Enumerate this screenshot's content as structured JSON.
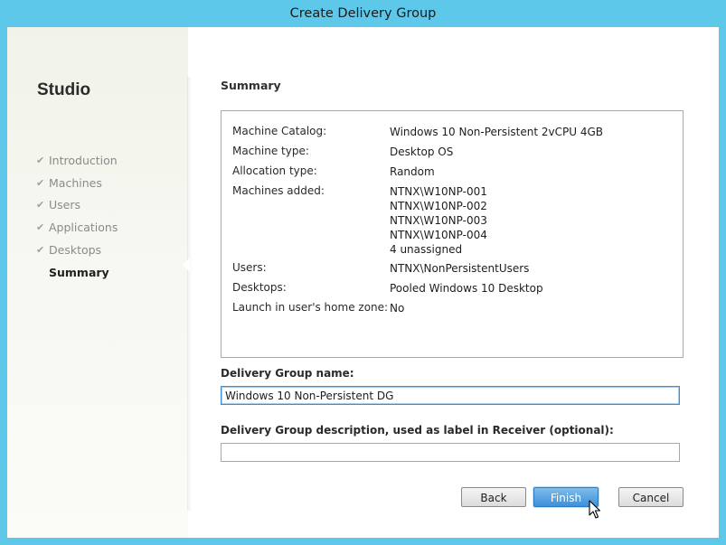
{
  "window": {
    "title": "Create Delivery Group"
  },
  "sidebar": {
    "app_name": "Studio",
    "steps": [
      {
        "label": "Introduction",
        "done": true
      },
      {
        "label": "Machines",
        "done": true
      },
      {
        "label": "Users",
        "done": true
      },
      {
        "label": "Applications",
        "done": true
      },
      {
        "label": "Desktops",
        "done": true
      },
      {
        "label": "Summary",
        "current": true
      }
    ]
  },
  "main": {
    "heading": "Summary",
    "summary": {
      "machine_catalog": {
        "label": "Machine Catalog:",
        "value": "Windows 10 Non-Persistent 2vCPU 4GB"
      },
      "machine_type": {
        "label": "Machine type:",
        "value": "Desktop OS"
      },
      "allocation_type": {
        "label": "Allocation type:",
        "value": "Random"
      },
      "machines_added": {
        "label": "Machines added:",
        "values": [
          "NTNX\\W10NP-001",
          "NTNX\\W10NP-002",
          "NTNX\\W10NP-003",
          "NTNX\\W10NP-004",
          "4 unassigned"
        ]
      },
      "users": {
        "label": "Users:",
        "value": "NTNX\\NonPersistentUsers"
      },
      "desktops": {
        "label": "Desktops:",
        "value": "Pooled Windows 10 Desktop"
      },
      "home_zone": {
        "label": "Launch in user's home zone:",
        "value": "No"
      }
    },
    "group_name": {
      "label": "Delivery Group name:",
      "value": "Windows 10 Non-Persistent DG"
    },
    "group_description": {
      "label": "Delivery Group description, used as label in Receiver (optional):",
      "value": ""
    }
  },
  "buttons": {
    "back": "Back",
    "finish": "Finish",
    "cancel": "Cancel"
  },
  "icons": {
    "step_done": "check-icon",
    "cursor": "mouse-pointer-icon"
  },
  "colors": {
    "window_frame": "#5ec8ea",
    "primary_button": "#3d90d9"
  }
}
